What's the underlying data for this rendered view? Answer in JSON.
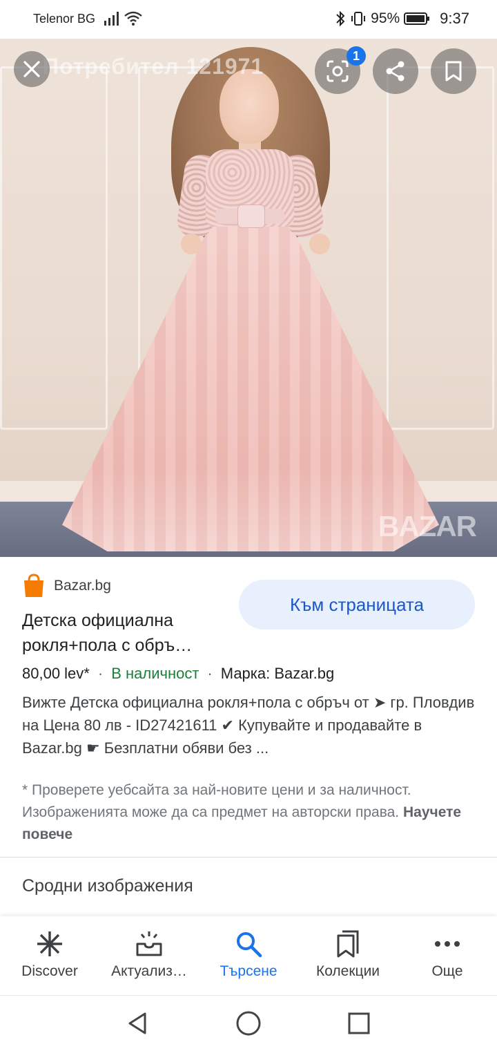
{
  "status_bar": {
    "carrier": "Telenor BG",
    "battery": "95%",
    "time": "9:37",
    "icons": [
      "signal-icon",
      "wifi-icon",
      "bluetooth-icon",
      "vibrate-icon",
      "battery-icon"
    ]
  },
  "image": {
    "watermark_user": "Потребител 121971",
    "watermark_brand": "BAZAR",
    "lens_badge": "1"
  },
  "result": {
    "source": "Bazar.bg",
    "visit_button": "Към страницата",
    "title_line1": "Детска официална",
    "title_line2": "рокля+пола с обръ…",
    "price": "80,00 lev*",
    "stock": "В наличност",
    "brand": "Марка: Bazar.bg",
    "description": "Вижте Детска официална рокля+пола с обръч от ➤ гр. Пловдив на Цена 80 лв - ID27421611 ✔ Купувайте и продавайте в Bazar.bg ☛ Безплатни обяви без ...",
    "disclaimer": "* Проверете уебсайта за най-новите цени и за наличност. Изображенията може да са предмет на авторски права.",
    "learn_more": "Научете повече"
  },
  "related_title": "Сродни изображения",
  "bottom_nav": {
    "discover": "Discover",
    "updates": "Актуализ…",
    "search": "Търсене",
    "collections": "Колекции",
    "more": "Още",
    "active": "search"
  },
  "colors": {
    "accent": "#1a73e8",
    "button_bg": "#e8f0fe",
    "stock_green": "#188038",
    "source_icon": "#f57c00"
  }
}
